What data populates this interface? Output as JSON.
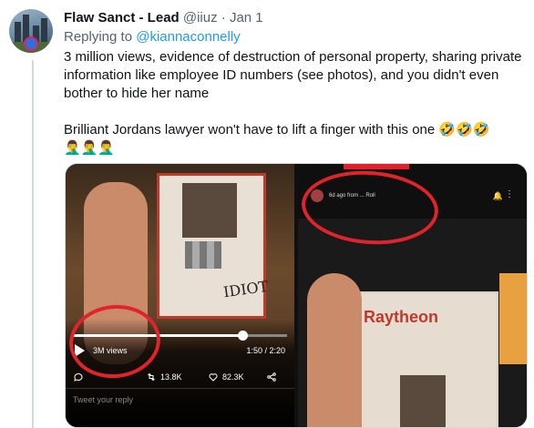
{
  "tweet": {
    "author_name": "Flaw Sanct - Lead",
    "handle": "@iiuz",
    "separator": "·",
    "date": "Jan 1",
    "replying_prefix": "Replying to ",
    "replying_to": "@kiannaconnelly",
    "paragraph1": "3 million views, evidence of destruction of personal property, sharing private information like employee ID numbers (see photos), and you didn't even bother to hide her name",
    "paragraph2_text": "Brilliant Jordans lawyer won't have to lift a finger with this one ",
    "paragraph2_emojis": "🤣🤣🤣",
    "paragraph2_emojis_line2": "🤦‍♂️🤦‍♂️🤦‍♂️"
  },
  "media_left": {
    "views_label": "3M views",
    "time_label": "1:50 / 2:20",
    "retweets": "13.8K",
    "likes": "82.3K",
    "reply_placeholder": "Tweet your reply",
    "scrawl": "IDIOT",
    "progress": 0.79
  },
  "media_right": {
    "header_text": "6d ago from ... Roll",
    "badge_brand": "Raytheon"
  },
  "colors": {
    "link": "#1d9bf0",
    "annotation_red": "#e0242b"
  }
}
